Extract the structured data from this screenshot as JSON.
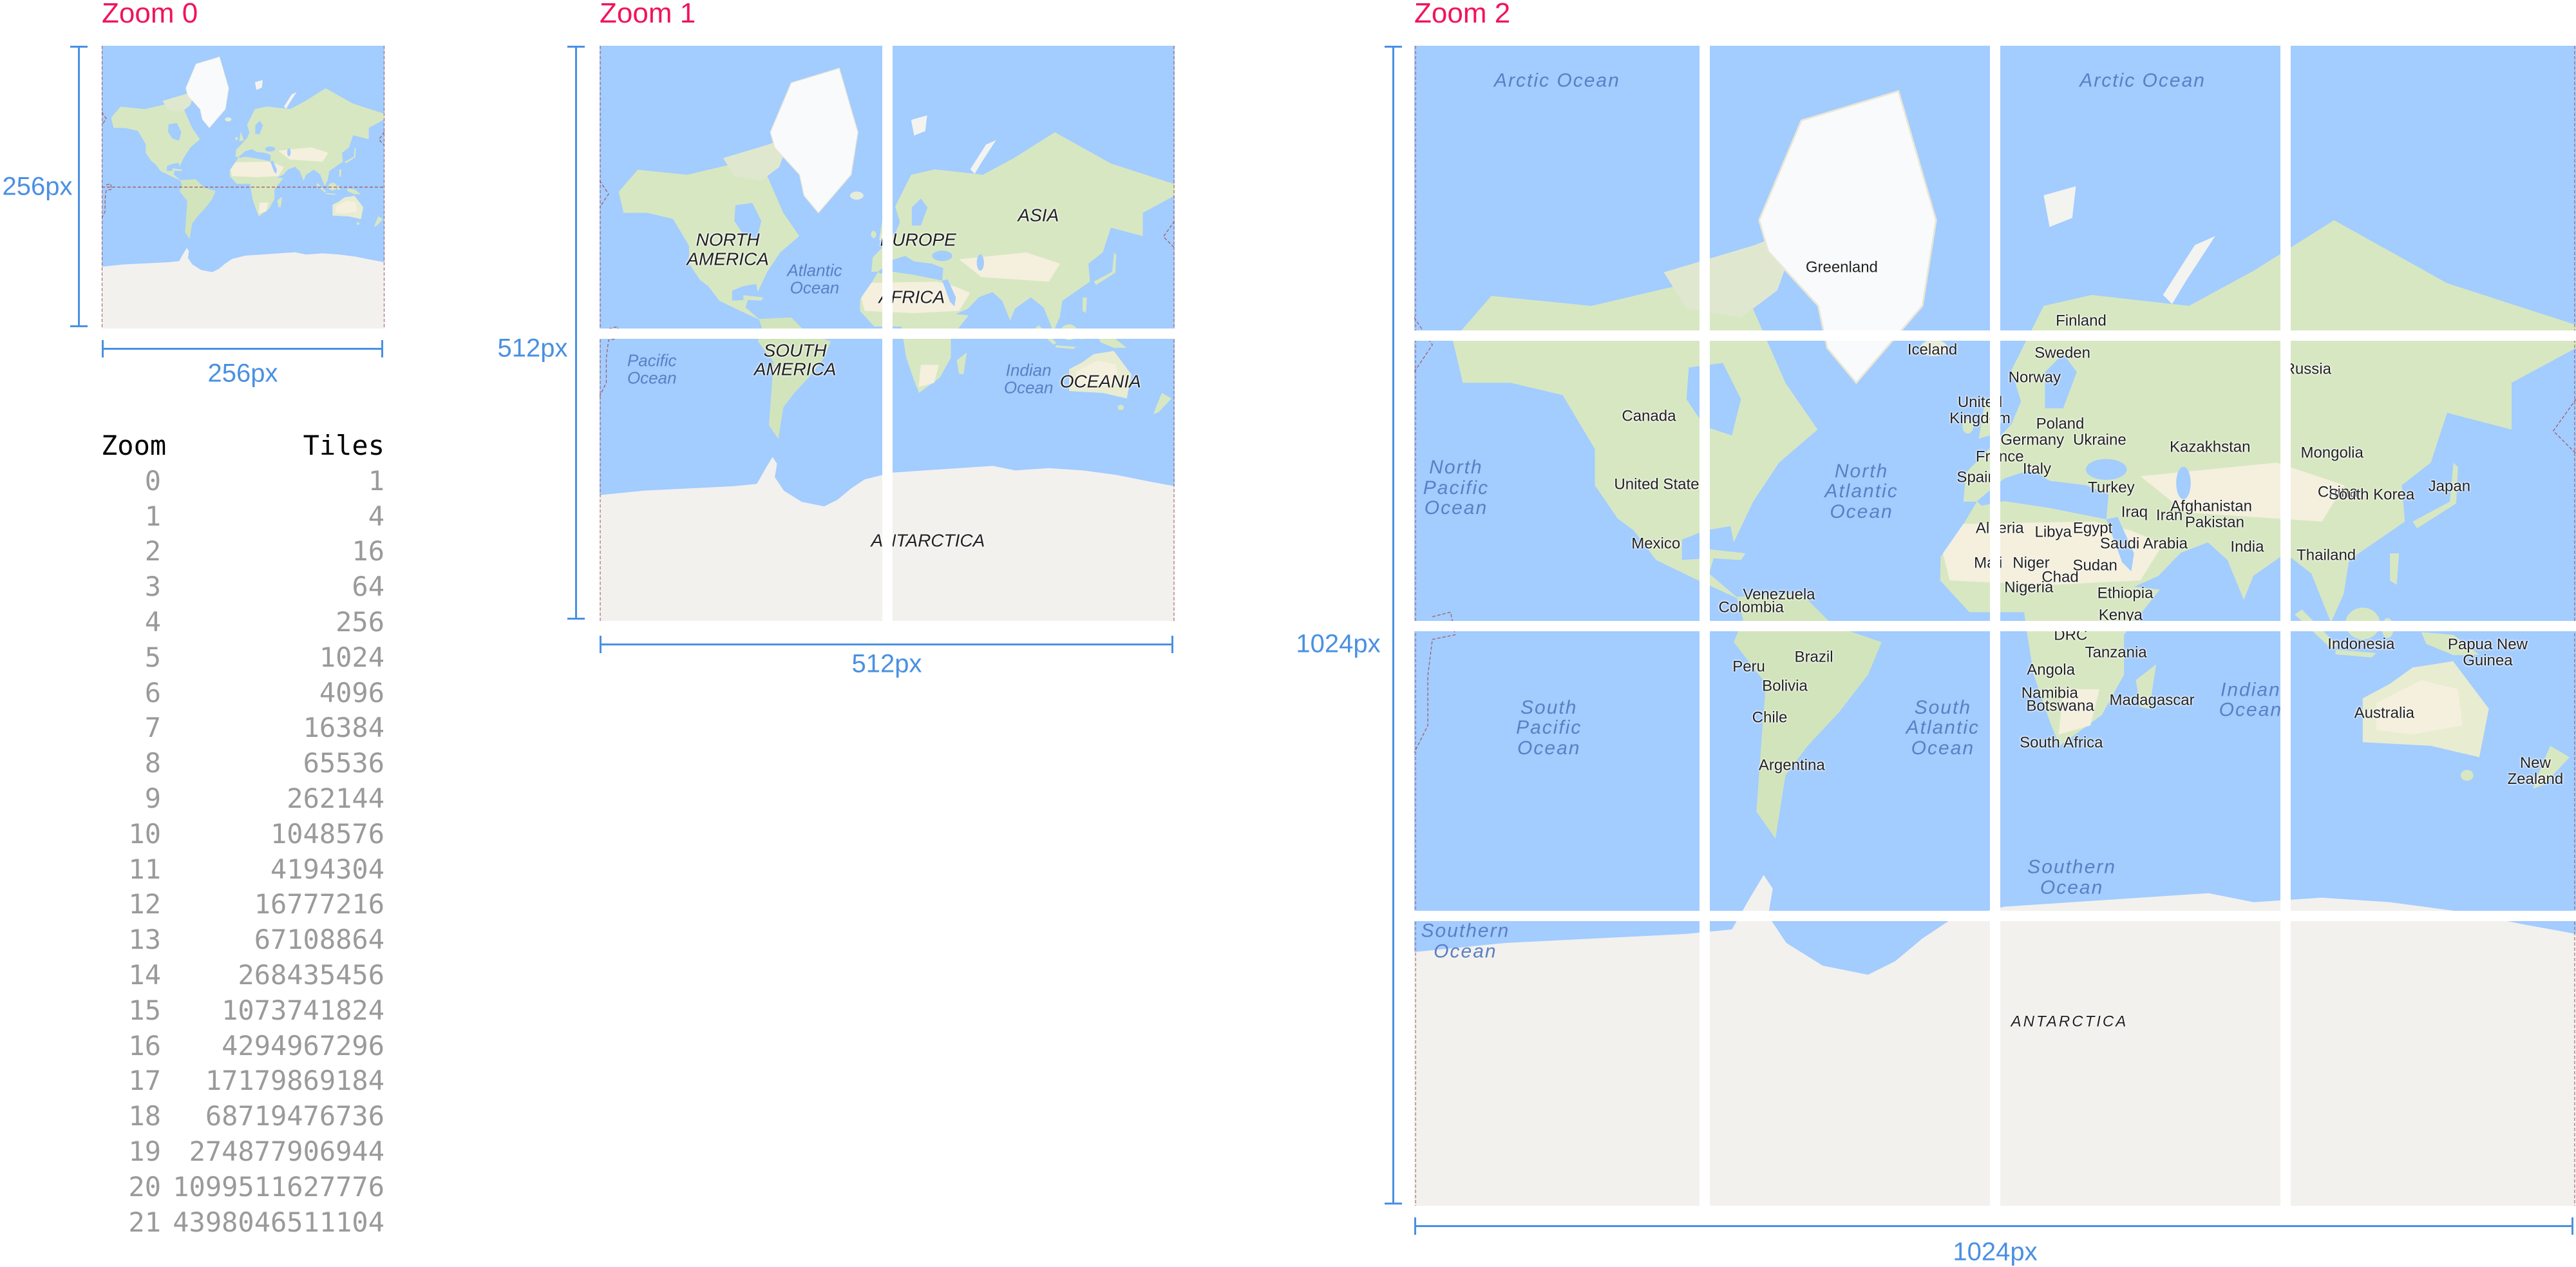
{
  "colors": {
    "title": "#f0145a",
    "dimension": "#4a90e2",
    "ocean": "#a3ccff",
    "land": "#d7e7c2",
    "desert": "#f4f0dd",
    "ice": "#f2f1ee"
  },
  "panels": [
    {
      "title": "Zoom 0",
      "height_label": "256px",
      "width_label": "256px",
      "labels": []
    },
    {
      "title": "Zoom 1",
      "height_label": "512px",
      "width_label": "512px",
      "labels": [
        {
          "text": "NORTH\nAMERICA",
          "kind": "continent"
        },
        {
          "text": "EUROPE",
          "kind": "continent"
        },
        {
          "text": "ASIA",
          "kind": "continent"
        },
        {
          "text": "Atlantic\nOcean",
          "kind": "ocean small"
        },
        {
          "text": "AFRICA",
          "kind": "continent"
        },
        {
          "text": "SOUTH\nAMERICA",
          "kind": "continent"
        },
        {
          "text": "Pacific\nOcean",
          "kind": "ocean small"
        },
        {
          "text": "Indian\nOcean",
          "kind": "ocean small"
        },
        {
          "text": "OCEANIA",
          "kind": "continent"
        },
        {
          "text": "ANTARCTICA",
          "kind": "continent"
        }
      ]
    },
    {
      "title": "Zoom 2",
      "height_label": "1024px",
      "width_label": "1024px",
      "labels": [
        {
          "text": "Arctic Ocean",
          "kind": "ocean"
        },
        {
          "text": "Arctic Ocean",
          "kind": "ocean"
        },
        {
          "text": "Greenland",
          "kind": "country"
        },
        {
          "text": "Finland",
          "kind": "country"
        },
        {
          "text": "Iceland",
          "kind": "country"
        },
        {
          "text": "Sweden",
          "kind": "country"
        },
        {
          "text": "Norway",
          "kind": "country"
        },
        {
          "text": "Russia",
          "kind": "country"
        },
        {
          "text": "United\nKingdom",
          "kind": "country"
        },
        {
          "text": "Poland",
          "kind": "country"
        },
        {
          "text": "Germany",
          "kind": "country"
        },
        {
          "text": "Ukraine",
          "kind": "country"
        },
        {
          "text": "Kazakhstan",
          "kind": "country"
        },
        {
          "text": "Mongolia",
          "kind": "country"
        },
        {
          "text": "France",
          "kind": "country"
        },
        {
          "text": "Spain",
          "kind": "country"
        },
        {
          "text": "Italy",
          "kind": "country"
        },
        {
          "text": "Turkey",
          "kind": "country"
        },
        {
          "text": "China",
          "kind": "country"
        },
        {
          "text": "South Korea",
          "kind": "country"
        },
        {
          "text": "Japan",
          "kind": "country"
        },
        {
          "text": "Canada",
          "kind": "country"
        },
        {
          "text": "United States",
          "kind": "country"
        },
        {
          "text": "Mexico",
          "kind": "country"
        },
        {
          "text": "North\nPacific\nOcean",
          "kind": "ocean"
        },
        {
          "text": "North\nAtlantic\nOcean",
          "kind": "ocean"
        },
        {
          "text": "Iraq",
          "kind": "country"
        },
        {
          "text": "Iran",
          "kind": "country"
        },
        {
          "text": "Afghanistan",
          "kind": "country"
        },
        {
          "text": "Pakistan",
          "kind": "country"
        },
        {
          "text": "Algeria",
          "kind": "country"
        },
        {
          "text": "Libya",
          "kind": "country"
        },
        {
          "text": "Egypt",
          "kind": "country"
        },
        {
          "text": "Saudi Arabia",
          "kind": "country"
        },
        {
          "text": "India",
          "kind": "country"
        },
        {
          "text": "Mali",
          "kind": "country"
        },
        {
          "text": "Niger",
          "kind": "country"
        },
        {
          "text": "Chad",
          "kind": "country"
        },
        {
          "text": "Sudan",
          "kind": "country"
        },
        {
          "text": "Nigeria",
          "kind": "country"
        },
        {
          "text": "Ethiopia",
          "kind": "country"
        },
        {
          "text": "Kenya",
          "kind": "country"
        },
        {
          "text": "Thailand",
          "kind": "country"
        },
        {
          "text": "Venezuela",
          "kind": "country"
        },
        {
          "text": "Colombia",
          "kind": "country"
        },
        {
          "text": "DRC",
          "kind": "country"
        },
        {
          "text": "Tanzania",
          "kind": "country"
        },
        {
          "text": "Peru",
          "kind": "country"
        },
        {
          "text": "Brazil",
          "kind": "country"
        },
        {
          "text": "Bolivia",
          "kind": "country"
        },
        {
          "text": "Angola",
          "kind": "country"
        },
        {
          "text": "Namibia",
          "kind": "country"
        },
        {
          "text": "Botswana",
          "kind": "country"
        },
        {
          "text": "Madagascar",
          "kind": "country"
        },
        {
          "text": "South Africa",
          "kind": "country"
        },
        {
          "text": "Chile",
          "kind": "country"
        },
        {
          "text": "Argentina",
          "kind": "country"
        },
        {
          "text": "South\nAtlantic\nOcean",
          "kind": "ocean"
        },
        {
          "text": "South\nPacific\nOcean",
          "kind": "ocean"
        },
        {
          "text": "Indian\nOcean",
          "kind": "ocean"
        },
        {
          "text": "Indonesia",
          "kind": "country"
        },
        {
          "text": "Papua New\nGuinea",
          "kind": "country"
        },
        {
          "text": "Australia",
          "kind": "country"
        },
        {
          "text": "New\nZealand",
          "kind": "country"
        },
        {
          "text": "Southern\nOcean",
          "kind": "ocean"
        },
        {
          "text": "Southern\nOcean",
          "kind": "ocean"
        },
        {
          "text": "ANTARCTICA",
          "kind": "antarctica"
        }
      ]
    }
  ],
  "table": {
    "headers": [
      "Zoom",
      "Tiles"
    ],
    "rows": [
      [
        "0",
        "1"
      ],
      [
        "1",
        "4"
      ],
      [
        "2",
        "16"
      ],
      [
        "3",
        "64"
      ],
      [
        "4",
        "256"
      ],
      [
        "5",
        "1024"
      ],
      [
        "6",
        "4096"
      ],
      [
        "7",
        "16384"
      ],
      [
        "8",
        "65536"
      ],
      [
        "9",
        "262144"
      ],
      [
        "10",
        "1048576"
      ],
      [
        "11",
        "4194304"
      ],
      [
        "12",
        "16777216"
      ],
      [
        "13",
        "67108864"
      ],
      [
        "14",
        "268435456"
      ],
      [
        "15",
        "1073741824"
      ],
      [
        "16",
        "4294967296"
      ],
      [
        "17",
        "17179869184"
      ],
      [
        "18",
        "68719476736"
      ],
      [
        "19",
        "274877906944"
      ],
      [
        "20",
        "1099511627776"
      ],
      [
        "21",
        "4398046511104"
      ]
    ]
  }
}
